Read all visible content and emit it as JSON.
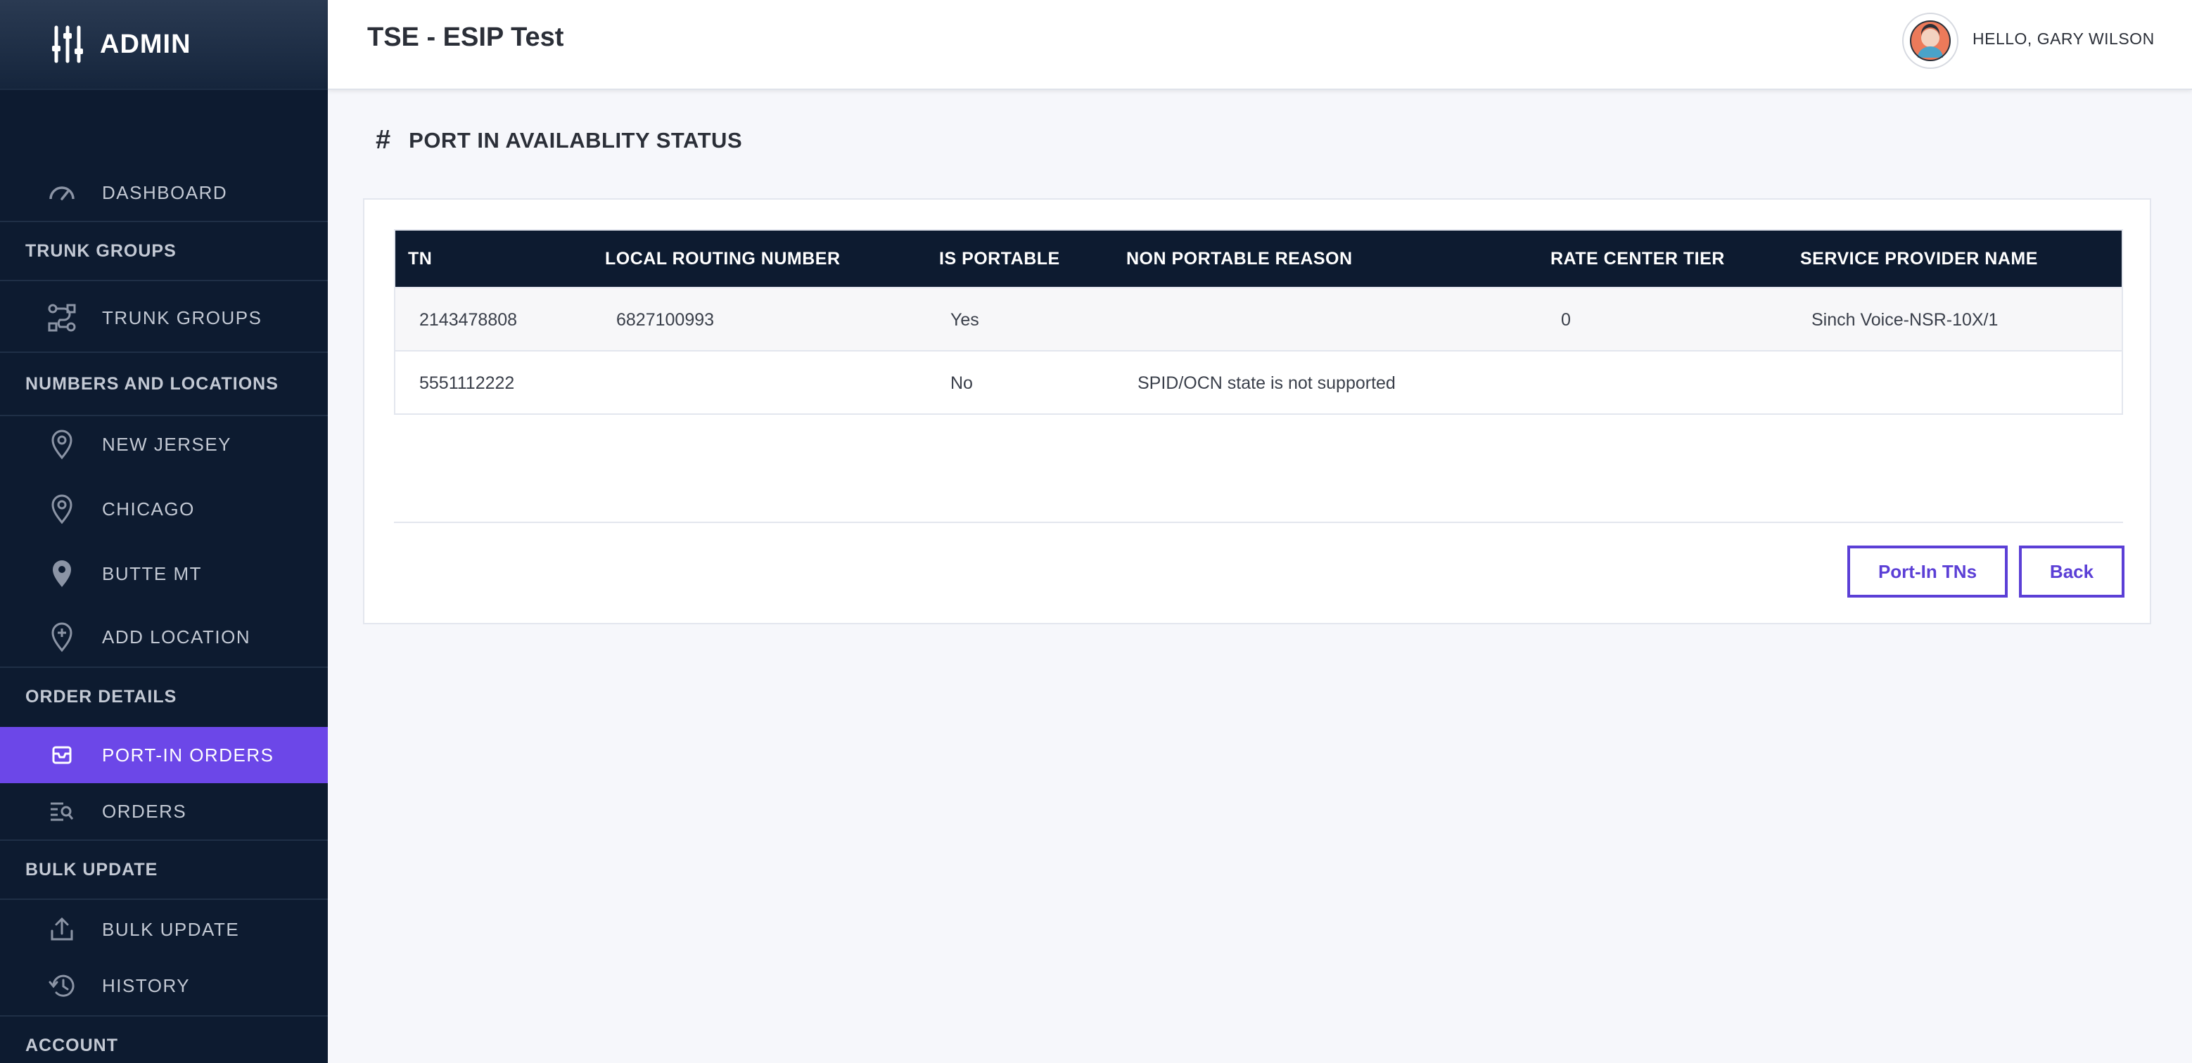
{
  "brand": {
    "name": "ADMIN",
    "icon": "sliders-icon"
  },
  "sidebar": {
    "dashboard": "DASHBOARD",
    "sections": {
      "trunk_groups": "TRUNK GROUPS",
      "numbers_locations": "NUMBERS AND LOCATIONS",
      "order_details": "ORDER DETAILS",
      "bulk_update": "BULK UPDATE",
      "account": "ACCOUNT"
    },
    "items": {
      "trunk_groups": "TRUNK GROUPS",
      "new_jersey": "NEW JERSEY",
      "chicago": "CHICAGO",
      "butte_mt": "BUTTE MT",
      "add_location": "ADD LOCATION",
      "port_in_orders": "PORT-IN ORDERS",
      "orders": "ORDERS",
      "bulk_update": "BULK UPDATE",
      "history": "HISTORY"
    },
    "active_item": "port_in_orders",
    "accent_color": "#6c47e8"
  },
  "header": {
    "title": "TSE - ESIP Test",
    "greeting": "HELLO, GARY WILSON"
  },
  "page": {
    "hash": "#",
    "heading": "PORT IN AVAILABLITY STATUS"
  },
  "table": {
    "columns": [
      "TN",
      "LOCAL ROUTING NUMBER",
      "IS PORTABLE",
      "NON PORTABLE REASON",
      "RATE CENTER TIER",
      "SERVICE PROVIDER NAME"
    ],
    "rows": [
      [
        "2143478808",
        "6827100993",
        "Yes",
        "",
        "0",
        "Sinch Voice-NSR-10X/1"
      ],
      [
        "5551112222",
        "",
        "No",
        "SPID/OCN state is not supported",
        "",
        ""
      ]
    ]
  },
  "buttons": {
    "port_in_tns": "Port-In TNs",
    "back": "Back"
  }
}
